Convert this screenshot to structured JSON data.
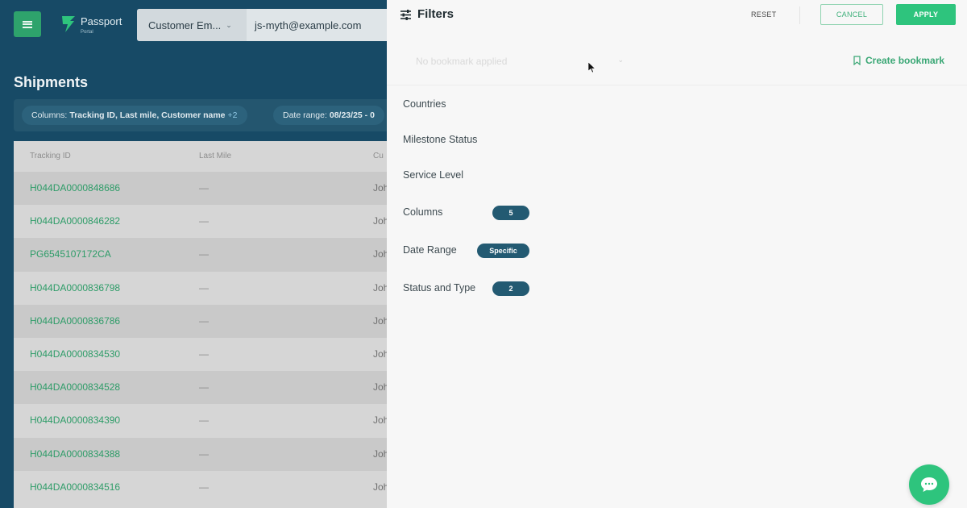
{
  "app": {
    "logo": {
      "name": "Passport",
      "sub": "Portal"
    },
    "search": {
      "field": "Customer Em...",
      "value": "js-myth@example.com"
    },
    "page_title": "Shipments",
    "filter_chips": {
      "columns_label": "Columns:",
      "columns_value": "Tracking ID, Last mile, Customer name",
      "columns_more": "+2",
      "date_label": "Date range:",
      "date_value": "08/23/25 - 0"
    },
    "table": {
      "headers": [
        "Tracking ID",
        "Last Mile",
        "Cu"
      ],
      "rows": [
        {
          "tracking_id": "H044DA0000848686",
          "last_mile": "—",
          "customer": "Joh"
        },
        {
          "tracking_id": "H044DA0000846282",
          "last_mile": "—",
          "customer": "Joh"
        },
        {
          "tracking_id": "PG6545107172CA",
          "last_mile": "—",
          "customer": "Joh"
        },
        {
          "tracking_id": "H044DA0000836798",
          "last_mile": "—",
          "customer": "Joh"
        },
        {
          "tracking_id": "H044DA0000836786",
          "last_mile": "—",
          "customer": "Joh"
        },
        {
          "tracking_id": "H044DA0000834530",
          "last_mile": "—",
          "customer": "Joh"
        },
        {
          "tracking_id": "H044DA0000834528",
          "last_mile": "—",
          "customer": "Joh"
        },
        {
          "tracking_id": "H044DA0000834390",
          "last_mile": "—",
          "customer": "Joh"
        },
        {
          "tracking_id": "H044DA0000834388",
          "last_mile": "—",
          "customer": "Joh"
        },
        {
          "tracking_id": "H044DA0000834516",
          "last_mile": "—",
          "customer": "Joh"
        }
      ]
    }
  },
  "panel": {
    "title": "Filters",
    "reset_label": "RESET",
    "cancel_label": "CANCEL",
    "apply_label": "APPLY",
    "bookmark_placeholder": "No bookmark applied",
    "create_bookmark_label": "Create bookmark",
    "filters": [
      {
        "label": "Countries",
        "badge": ""
      },
      {
        "label": "Milestone Status",
        "badge": ""
      },
      {
        "label": "Service Level",
        "badge": ""
      },
      {
        "label": "Columns",
        "badge": "5"
      },
      {
        "label": "Date Range",
        "badge": "Specific"
      },
      {
        "label": "Status and Type",
        "badge": "2"
      }
    ]
  },
  "colors": {
    "brand_green": "#2ec47d",
    "navy": "#174a66",
    "badge": "#235a72",
    "link_green": "#2e9c68"
  }
}
